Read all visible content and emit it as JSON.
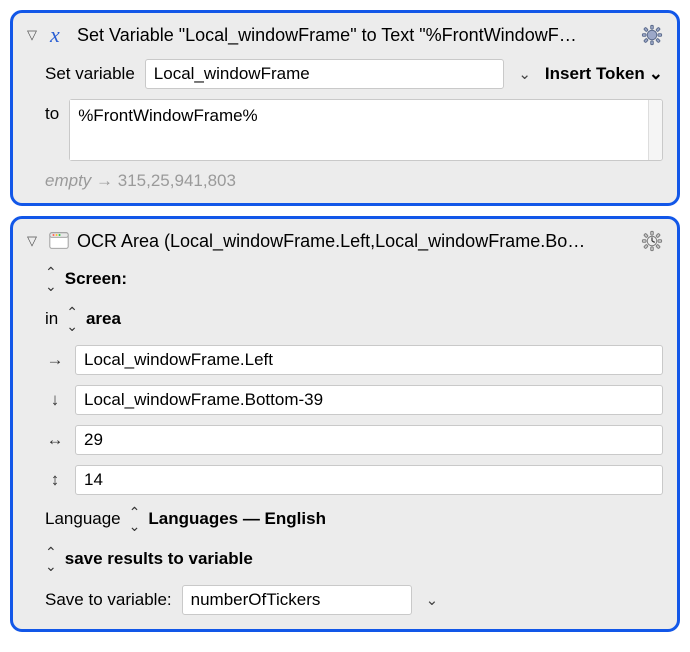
{
  "action1": {
    "title": "Set Variable \"Local_windowFrame\" to Text \"%FrontWindowF…",
    "set_variable_label": "Set variable",
    "variable_name": "Local_windowFrame",
    "insert_token_label": "Insert Token",
    "to_label": "to",
    "to_value": "%FrontWindowFrame%",
    "empty_label": "empty",
    "arrow": "→",
    "result_value": "315,25,941,803"
  },
  "action2": {
    "title": "OCR Area (Local_windowFrame.Left,Local_windowFrame.Bo…",
    "screen_label": "Screen:",
    "in_label": "in",
    "area_label": "area",
    "coord_right": "Local_windowFrame.Left",
    "coord_down": "Local_windowFrame.Bottom-39",
    "coord_width": "29",
    "coord_height": "14",
    "language_label": "Language",
    "languages_value": "Languages — English",
    "save_results_label": "save results to variable",
    "save_to_label": "Save to variable:",
    "save_to_value": "numberOfTickers"
  }
}
